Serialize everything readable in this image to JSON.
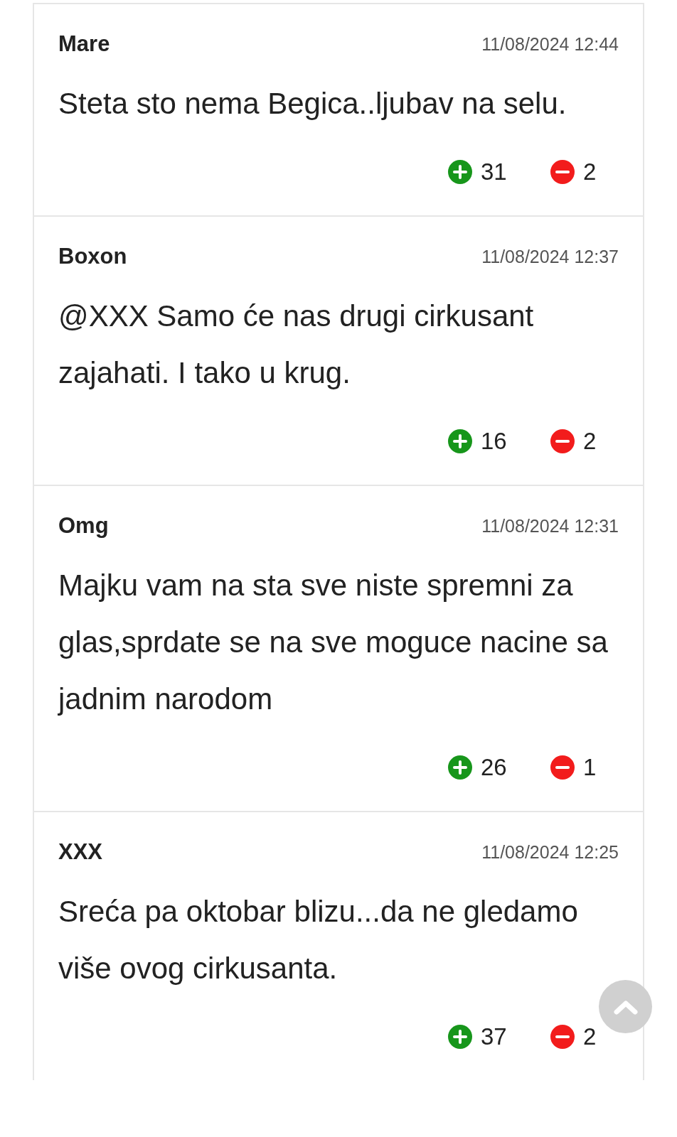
{
  "comments": [
    {
      "author": "Mare",
      "date": "11/08/2024 12:44",
      "text": "Steta sto nema Begica..ljubav na selu.",
      "likes": "31",
      "dislikes": "2"
    },
    {
      "author": "Boxon",
      "date": "11/08/2024 12:37",
      "text": "@XXX Samo će nas drugi cirkusant zajahati. I tako u krug.",
      "likes": "16",
      "dislikes": "2"
    },
    {
      "author": "Omg",
      "date": "11/08/2024 12:31",
      "text": "Majku vam na sta sve niste spremni za glas,sprdate se na sve moguce nacine sa jadnim narodom",
      "likes": "26",
      "dislikes": "1"
    },
    {
      "author": "XXX",
      "date": "11/08/2024 12:25",
      "text": "Sreća pa oktobar blizu...da ne gledamo više ovog cirkusanta.",
      "likes": "37",
      "dislikes": "2"
    }
  ]
}
